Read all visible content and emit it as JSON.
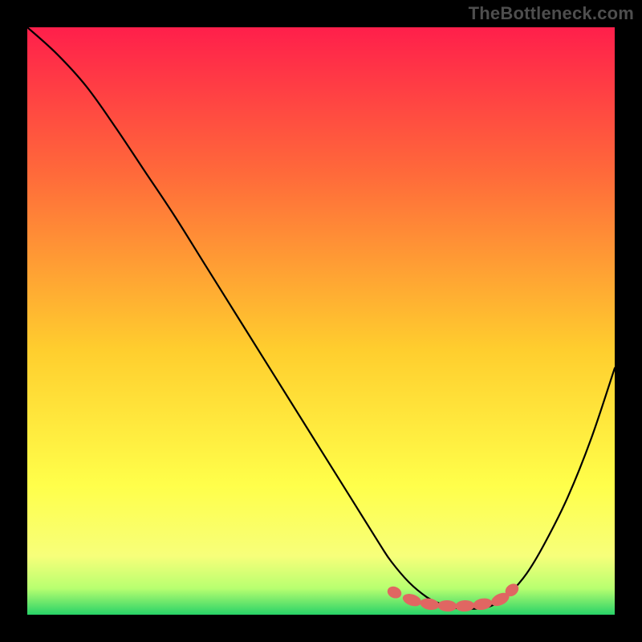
{
  "watermark": "TheBottleneck.com",
  "chart_data": {
    "type": "line",
    "title": "",
    "xlabel": "",
    "ylabel": "",
    "xlim": [
      0,
      100
    ],
    "ylim": [
      0,
      100
    ],
    "grid": false,
    "legend": false,
    "series": [
      {
        "name": "curve",
        "x": [
          0,
          5,
          10,
          15,
          20,
          25,
          30,
          35,
          40,
          45,
          50,
          55,
          60,
          62,
          65,
          68,
          70,
          72,
          74,
          76,
          78,
          80,
          82,
          85,
          88,
          92,
          96,
          100
        ],
        "y": [
          100,
          95.5,
          90,
          83,
          75.5,
          68,
          60,
          52,
          44,
          36,
          28,
          20,
          12,
          9,
          5.5,
          3,
          2,
          1.3,
          1,
          1,
          1.2,
          2,
          3.5,
          7,
          12,
          20,
          30,
          42
        ],
        "color": "#000000"
      },
      {
        "name": "markers",
        "points": [
          {
            "x": 62.5,
            "y": 3.8
          },
          {
            "x": 65.5,
            "y": 2.5
          },
          {
            "x": 68.5,
            "y": 1.8
          },
          {
            "x": 71.5,
            "y": 1.5
          },
          {
            "x": 74.5,
            "y": 1.5
          },
          {
            "x": 77.5,
            "y": 1.8
          },
          {
            "x": 80.5,
            "y": 2.6
          },
          {
            "x": 82.5,
            "y": 4.2
          }
        ],
        "color": "#e06662"
      }
    ],
    "bands": [
      {
        "y0": 0,
        "y1": 4,
        "color": "#2bd46a"
      },
      {
        "y0": 4,
        "y1": 10,
        "color": "linear-green-yellow"
      }
    ],
    "background_gradient": {
      "stops": [
        {
          "offset": 0.0,
          "color": "#ff1f4b"
        },
        {
          "offset": 0.25,
          "color": "#ff6a3a"
        },
        {
          "offset": 0.55,
          "color": "#ffce2e"
        },
        {
          "offset": 0.78,
          "color": "#ffff4a"
        },
        {
          "offset": 0.9,
          "color": "#f7ff7a"
        },
        {
          "offset": 0.955,
          "color": "#b8ff70"
        },
        {
          "offset": 1.0,
          "color": "#28d268"
        }
      ]
    }
  }
}
